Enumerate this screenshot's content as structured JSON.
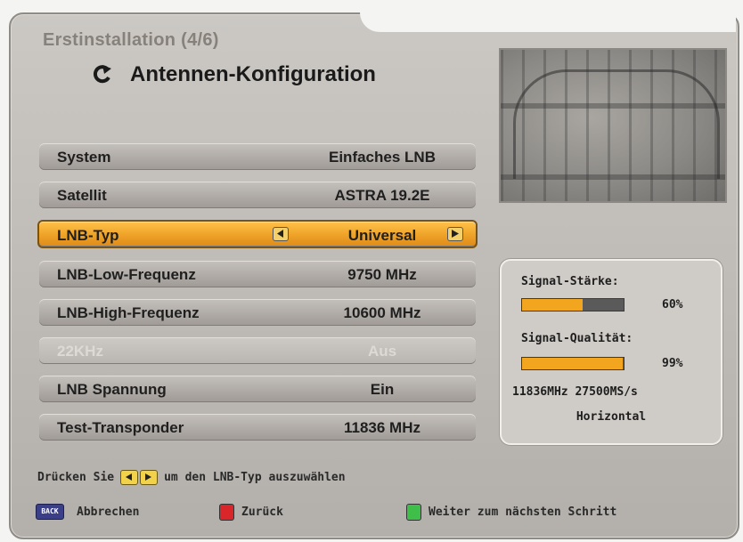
{
  "header": {
    "title": "Erstinstallation (4/6)",
    "subtitle": "Antennen-Konfiguration"
  },
  "settings": [
    {
      "label": "System",
      "value": "Einfaches LNB",
      "state": "normal"
    },
    {
      "label": "Satellit",
      "value": "ASTRA 19.2E",
      "state": "normal"
    },
    {
      "label": "LNB-Typ",
      "value": "Universal",
      "state": "selected"
    },
    {
      "label": "LNB-Low-Frequenz",
      "value": "9750 MHz",
      "state": "normal"
    },
    {
      "label": "LNB-High-Frequenz",
      "value": "10600 MHz",
      "state": "normal"
    },
    {
      "label": "22KHz",
      "value": "Aus",
      "state": "disabled"
    },
    {
      "label": "LNB Spannung",
      "value": "Ein",
      "state": "normal"
    },
    {
      "label": "Test-Transponder",
      "value": "11836 MHz",
      "state": "normal"
    }
  ],
  "signal": {
    "strength_label": "Signal-Stärke:",
    "strength_pct": "60%",
    "strength_level": 0.6,
    "quality_label": "Signal-Qualität:",
    "quality_pct": "99%",
    "quality_level": 0.99,
    "transponder": "11836MHz 27500MS/s",
    "polarization": "Horizontal"
  },
  "hint": {
    "prefix": "Drücken Sie",
    "suffix": "um den LNB-Typ auszuwählen"
  },
  "footer": {
    "back_key": "BACK",
    "cancel": "Abbrechen",
    "back": "Zurück",
    "next": "Weiter zum nächsten Schritt"
  },
  "colors": {
    "selected": "#f0a52a",
    "signal_fill": "#f2a51e",
    "red_key": "#d8262a",
    "green_key": "#3fbf4a",
    "back_key": "#3b3f88"
  }
}
